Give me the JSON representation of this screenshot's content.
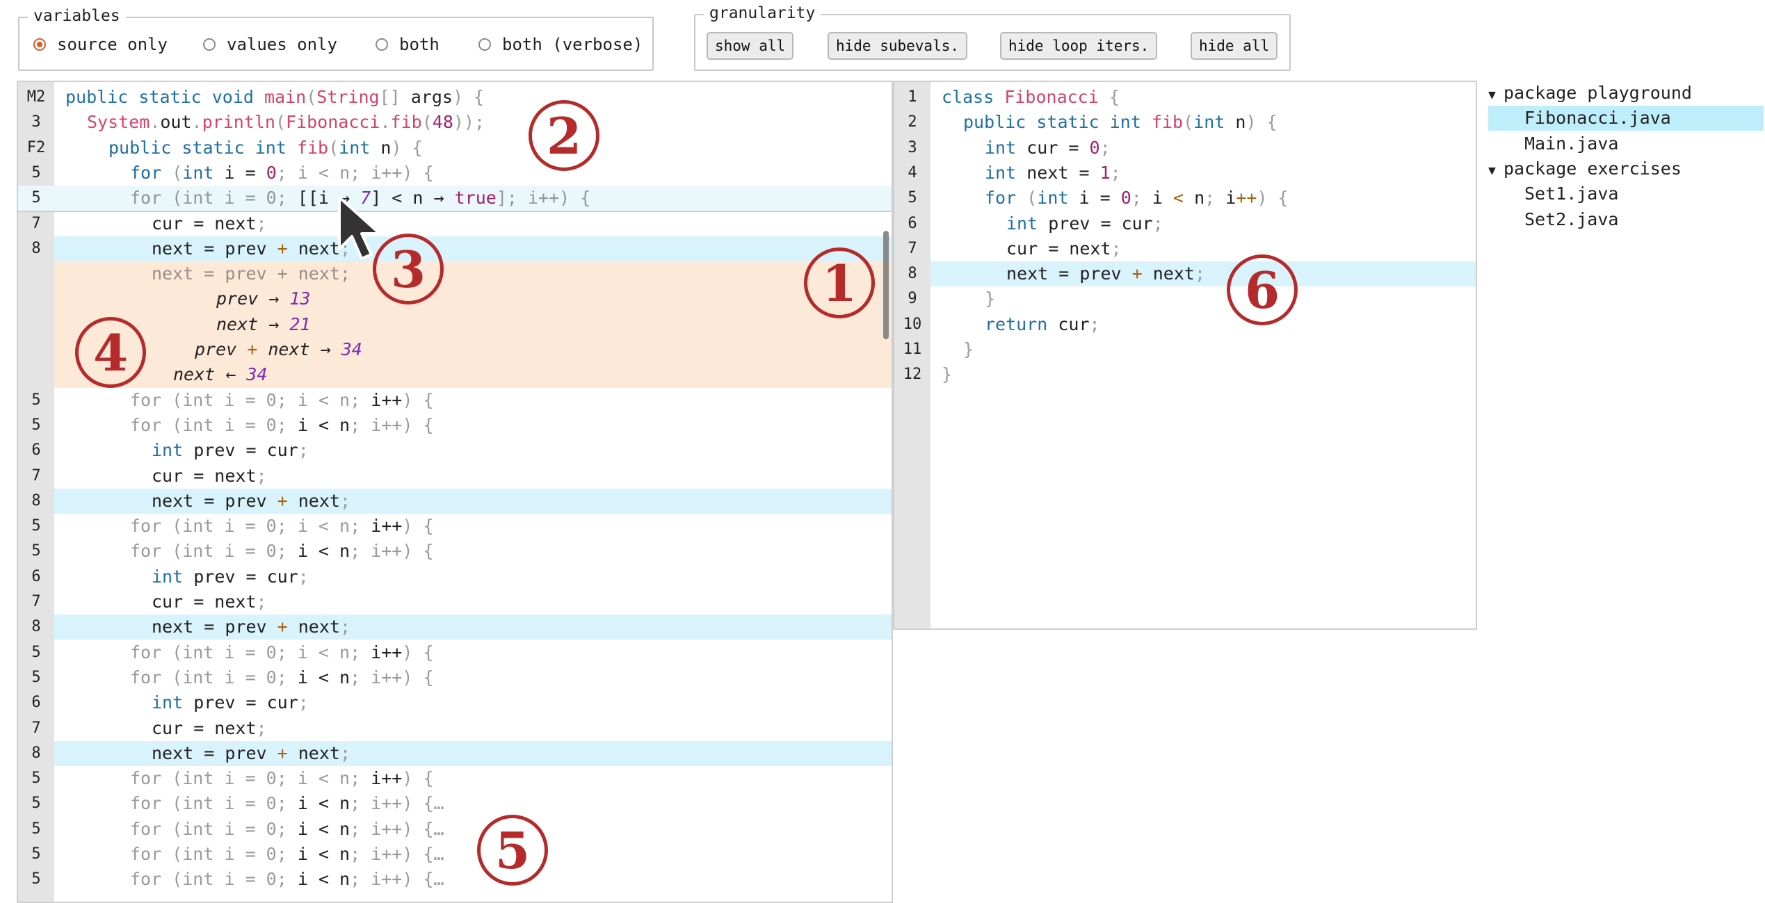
{
  "variables": {
    "legend": "variables",
    "options": [
      {
        "label": "source only",
        "selected": true
      },
      {
        "label": "values only",
        "selected": false
      },
      {
        "label": "both",
        "selected": false
      },
      {
        "label": "both (verbose)",
        "selected": false
      }
    ]
  },
  "granularity": {
    "legend": "granularity",
    "buttons": [
      "show all",
      "hide subevals.",
      "hide loop iters.",
      "hide all"
    ]
  },
  "trace_panel": {
    "lines": [
      {
        "ln": "M2",
        "tokens": [
          [
            "kw",
            "public static void "
          ],
          [
            "fn",
            "main"
          ],
          [
            "pu",
            "("
          ],
          [
            "ty",
            "String"
          ],
          [
            "pu",
            "[] "
          ],
          [
            "",
            "args"
          ],
          [
            "pu",
            ") {"
          ]
        ],
        "indent": 0
      },
      {
        "ln": "3",
        "tokens": [
          [
            "fn",
            "System"
          ],
          [
            "pu",
            "."
          ],
          [
            "",
            "out"
          ],
          [
            "pu",
            "."
          ],
          [
            "fn",
            "println"
          ],
          [
            "pu",
            "("
          ],
          [
            "fn",
            "Fibonacci"
          ],
          [
            "pu",
            "."
          ],
          [
            "fn",
            "fib"
          ],
          [
            "pu",
            "("
          ],
          [
            "num",
            "48"
          ],
          [
            "pu",
            "));"
          ]
        ],
        "indent": 1
      },
      {
        "ln": "F2",
        "tokens": [
          [
            "kw",
            "public static int "
          ],
          [
            "fn",
            "fib"
          ],
          [
            "pu",
            "("
          ],
          [
            "kw",
            "int "
          ],
          [
            "",
            "n"
          ],
          [
            "pu",
            ") {"
          ]
        ],
        "indent": 2
      },
      {
        "ln": "5",
        "tokens": [
          [
            "kw",
            "for "
          ],
          [
            "pu",
            "("
          ],
          [
            "kw",
            "int "
          ],
          [
            "",
            "i = "
          ],
          [
            "num",
            "0"
          ],
          [
            "pu",
            "; "
          ],
          [
            "dim",
            "i < n; i++"
          ],
          [
            "pu",
            ") {"
          ]
        ],
        "indent": 3
      },
      {
        "ln": "5",
        "tokens": [
          [
            "dim",
            "for (int i = 0; "
          ],
          [
            "",
            "[[i → "
          ],
          [
            "vr",
            "7"
          ],
          [
            "",
            "] < n → "
          ],
          [
            "num",
            "true"
          ],
          [
            "pu",
            "]"
          ],
          [
            "dim",
            "; i++) {"
          ]
        ],
        "indent": 3
      },
      {
        "ln": "7",
        "tokens": [
          [
            "",
            "cur = next"
          ],
          [
            "pu",
            ";"
          ]
        ],
        "indent": 4
      },
      {
        "ln": "8",
        "tokens": [
          [
            "",
            "next = prev "
          ],
          [
            "op",
            "+"
          ],
          [
            "",
            " next"
          ],
          [
            "pu",
            ";"
          ]
        ],
        "indent": 4
      },
      {
        "ln": "",
        "tokens": [
          [
            "dim",
            "next = prev + next;"
          ]
        ],
        "indent": 4
      },
      {
        "ln": "",
        "tokens": [
          [
            "it",
            "prev → "
          ],
          [
            "vr",
            "13"
          ]
        ],
        "indent": 7
      },
      {
        "ln": "",
        "tokens": [
          [
            "it",
            "next → "
          ],
          [
            "vr",
            "21"
          ]
        ],
        "indent": 7
      },
      {
        "ln": "",
        "tokens": [
          [
            "it",
            "prev "
          ],
          [
            "op",
            "+"
          ],
          [
            "it",
            " next → "
          ],
          [
            "vr",
            "34"
          ]
        ],
        "indent": 6
      },
      {
        "ln": "",
        "tokens": [
          [
            "it",
            "next ← "
          ],
          [
            "vr",
            "34"
          ]
        ],
        "indent": 5
      },
      {
        "ln": "5",
        "tokens": [
          [
            "dim",
            "for (int i = 0; i < n; "
          ],
          [
            "",
            "i++"
          ],
          [
            "dim",
            ") {"
          ]
        ],
        "indent": 3
      },
      {
        "ln": "5",
        "tokens": [
          [
            "dim",
            "for (int i = 0; "
          ],
          [
            "",
            "i < n"
          ],
          [
            "dim",
            "; i++) {"
          ]
        ],
        "indent": 3
      },
      {
        "ln": "6",
        "tokens": [
          [
            "kw",
            "int "
          ],
          [
            "",
            "prev = cur"
          ],
          [
            "pu",
            ";"
          ]
        ],
        "indent": 4
      },
      {
        "ln": "7",
        "tokens": [
          [
            "",
            "cur = next"
          ],
          [
            "pu",
            ";"
          ]
        ],
        "indent": 4
      },
      {
        "ln": "8",
        "tokens": [
          [
            "",
            "next = prev "
          ],
          [
            "op",
            "+"
          ],
          [
            "",
            " next"
          ],
          [
            "pu",
            ";"
          ]
        ],
        "indent": 4
      },
      {
        "ln": "5",
        "tokens": [
          [
            "dim",
            "for (int i = 0; i < n; "
          ],
          [
            "",
            "i++"
          ],
          [
            "dim",
            ") {"
          ]
        ],
        "indent": 3
      },
      {
        "ln": "5",
        "tokens": [
          [
            "dim",
            "for (int i = 0; "
          ],
          [
            "",
            "i < n"
          ],
          [
            "dim",
            "; i++) {"
          ]
        ],
        "indent": 3
      },
      {
        "ln": "6",
        "tokens": [
          [
            "kw",
            "int "
          ],
          [
            "",
            "prev = cur"
          ],
          [
            "pu",
            ";"
          ]
        ],
        "indent": 4
      },
      {
        "ln": "7",
        "tokens": [
          [
            "",
            "cur = next"
          ],
          [
            "pu",
            ";"
          ]
        ],
        "indent": 4
      },
      {
        "ln": "8",
        "tokens": [
          [
            "",
            "next = prev "
          ],
          [
            "op",
            "+"
          ],
          [
            "",
            " next"
          ],
          [
            "pu",
            ";"
          ]
        ],
        "indent": 4
      },
      {
        "ln": "5",
        "tokens": [
          [
            "dim",
            "for (int i = 0; i < n; "
          ],
          [
            "",
            "i++"
          ],
          [
            "dim",
            ") {"
          ]
        ],
        "indent": 3
      },
      {
        "ln": "5",
        "tokens": [
          [
            "dim",
            "for (int i = 0; "
          ],
          [
            "",
            "i < n"
          ],
          [
            "dim",
            "; i++) {"
          ]
        ],
        "indent": 3
      },
      {
        "ln": "6",
        "tokens": [
          [
            "kw",
            "int "
          ],
          [
            "",
            "prev = cur"
          ],
          [
            "pu",
            ";"
          ]
        ],
        "indent": 4
      },
      {
        "ln": "7",
        "tokens": [
          [
            "",
            "cur = next"
          ],
          [
            "pu",
            ";"
          ]
        ],
        "indent": 4
      },
      {
        "ln": "8",
        "tokens": [
          [
            "",
            "next = prev "
          ],
          [
            "op",
            "+"
          ],
          [
            "",
            " next"
          ],
          [
            "pu",
            ";"
          ]
        ],
        "indent": 4
      },
      {
        "ln": "5",
        "tokens": [
          [
            "dim",
            "for (int i = 0; i < n; "
          ],
          [
            "",
            "i++"
          ],
          [
            "dim",
            ") {"
          ]
        ],
        "indent": 3
      },
      {
        "ln": "5",
        "tokens": [
          [
            "dim",
            "for (int i = 0; "
          ],
          [
            "",
            "i < n"
          ],
          [
            "dim",
            "; i++) {"
          ],
          [
            "pu",
            "…"
          ]
        ],
        "indent": 3
      },
      {
        "ln": "5",
        "tokens": [
          [
            "dim",
            "for (int i = 0; "
          ],
          [
            "",
            "i < n"
          ],
          [
            "dim",
            "; i++) {"
          ],
          [
            "pu",
            "…"
          ]
        ],
        "indent": 3
      },
      {
        "ln": "5",
        "tokens": [
          [
            "dim",
            "for (int i = 0; "
          ],
          [
            "",
            "i < n"
          ],
          [
            "dim",
            "; i++) {"
          ],
          [
            "pu",
            "…"
          ]
        ],
        "indent": 3
      },
      {
        "ln": "5",
        "tokens": [
          [
            "dim",
            "for (int i = 0; "
          ],
          [
            "",
            "i < n"
          ],
          [
            "dim",
            "; i++) {"
          ],
          [
            "pu",
            "…"
          ]
        ],
        "indent": 3
      }
    ]
  },
  "source_panel": {
    "lines": [
      {
        "ln": "1",
        "tokens": [
          [
            "kw",
            "class "
          ],
          [
            "fn",
            "Fibonacci"
          ],
          [
            "pu",
            " {"
          ]
        ],
        "indent": 0
      },
      {
        "ln": "2",
        "tokens": [
          [
            "kw",
            "public static int "
          ],
          [
            "fn",
            "fib"
          ],
          [
            "pu",
            "("
          ],
          [
            "kw",
            "int "
          ],
          [
            "",
            "n"
          ],
          [
            "pu",
            ") {"
          ]
        ],
        "indent": 1
      },
      {
        "ln": "3",
        "tokens": [
          [
            "kw",
            "int "
          ],
          [
            "",
            "cur = "
          ],
          [
            "num",
            "0"
          ],
          [
            "pu",
            ";"
          ]
        ],
        "indent": 2
      },
      {
        "ln": "4",
        "tokens": [
          [
            "kw",
            "int "
          ],
          [
            "",
            "next = "
          ],
          [
            "num",
            "1"
          ],
          [
            "pu",
            ";"
          ]
        ],
        "indent": 2
      },
      {
        "ln": "5",
        "tokens": [
          [
            "kw",
            "for "
          ],
          [
            "pu",
            "("
          ],
          [
            "kw",
            "int "
          ],
          [
            "",
            "i = "
          ],
          [
            "num",
            "0"
          ],
          [
            "pu",
            "; "
          ],
          [
            "",
            "i "
          ],
          [
            "op",
            "<"
          ],
          [
            "",
            " n"
          ],
          [
            "pu",
            "; "
          ],
          [
            "",
            "i"
          ],
          [
            "op",
            "++"
          ],
          [
            "pu",
            ") {"
          ]
        ],
        "indent": 2
      },
      {
        "ln": "6",
        "tokens": [
          [
            "kw",
            "int "
          ],
          [
            "",
            "prev = cur"
          ],
          [
            "pu",
            ";"
          ]
        ],
        "indent": 3
      },
      {
        "ln": "7",
        "tokens": [
          [
            "",
            "cur = next"
          ],
          [
            "pu",
            ";"
          ]
        ],
        "indent": 3
      },
      {
        "ln": "8",
        "tokens": [
          [
            "",
            "next = prev "
          ],
          [
            "op",
            "+"
          ],
          [
            "",
            " next"
          ],
          [
            "pu",
            ";"
          ]
        ],
        "indent": 3
      },
      {
        "ln": "9",
        "tokens": [
          [
            "pu",
            "}"
          ]
        ],
        "indent": 2
      },
      {
        "ln": "10",
        "tokens": [
          [
            "kw",
            "return "
          ],
          [
            "",
            "cur"
          ],
          [
            "pu",
            ";"
          ]
        ],
        "indent": 2
      },
      {
        "ln": "11",
        "tokens": [
          [
            "pu",
            "}"
          ]
        ],
        "indent": 1
      },
      {
        "ln": "12",
        "tokens": [
          [
            "pu",
            "}"
          ]
        ],
        "indent": 0
      }
    ]
  },
  "file_tree": [
    {
      "label": "package playground",
      "type": "package"
    },
    {
      "label": "Fibonacci.java",
      "type": "file",
      "selected": true
    },
    {
      "label": "Main.java",
      "type": "file"
    },
    {
      "label": "package exercises",
      "type": "package"
    },
    {
      "label": "Set1.java",
      "type": "file"
    },
    {
      "label": "Set2.java",
      "type": "file"
    }
  ],
  "markers": [
    "1",
    "2",
    "3",
    "4",
    "5",
    "6"
  ],
  "colors": {
    "accent": "#e05a2b",
    "highlight": "#d8f3fb",
    "subeval": "#fde9d8",
    "marker": "#b52a2a"
  }
}
